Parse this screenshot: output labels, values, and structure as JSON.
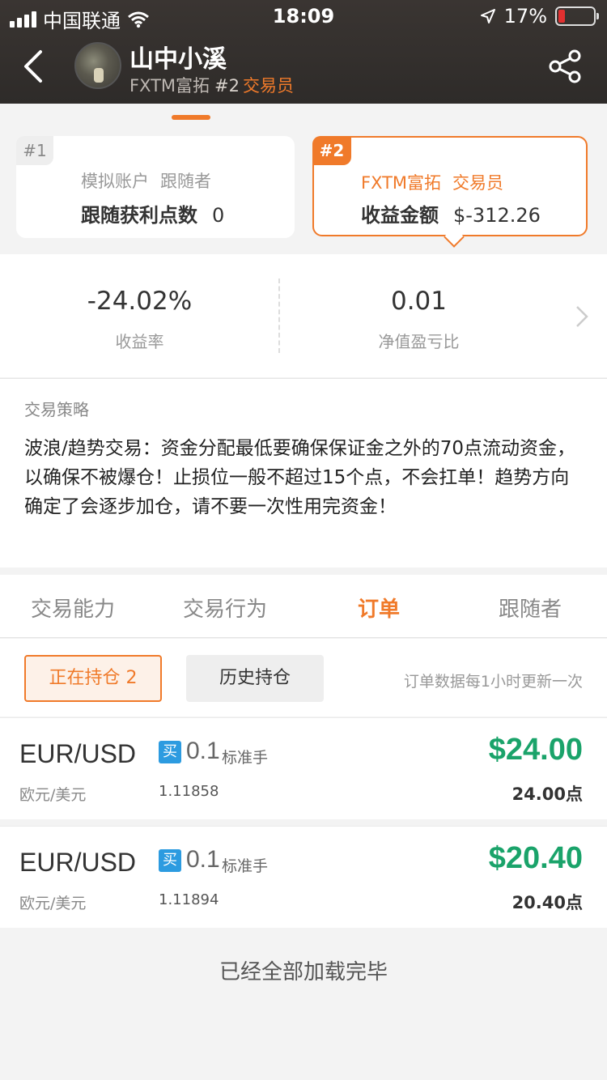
{
  "status_bar": {
    "carrier": "中国联通",
    "time": "18:09",
    "battery": "17%",
    "icons": [
      "signal-icon",
      "wifi-icon",
      "location-arrow-icon",
      "battery-icon"
    ]
  },
  "header": {
    "name": "山中小溪",
    "broker": "FXTM富拓",
    "rank": "#2",
    "role": "交易员",
    "icons": [
      "back-icon",
      "avatar",
      "share-icon"
    ]
  },
  "cards": [
    {
      "badge": "#1",
      "line1a": "模拟账户",
      "line1b": "跟随者",
      "label": "跟随获利点数",
      "value": "0"
    },
    {
      "badge": "#2",
      "line1a": "FXTM富拓",
      "line1b": "交易员",
      "label": "收益金额",
      "value": "$-312.26"
    }
  ],
  "stats": [
    {
      "value": "-24.02%",
      "label": "收益率"
    },
    {
      "value": "0.01",
      "label": "净值盈亏比"
    }
  ],
  "strategy": {
    "title": "交易策略",
    "text": "波浪/趋势交易：资金分配最低要确保保证金之外的70点流动资金，以确保不被爆仓！止损位一般不超过15个点，不会扛单！趋势方向确定了会逐步加仓，请不要一次性用完资金！"
  },
  "tabs": [
    {
      "label": "交易能力",
      "active": false
    },
    {
      "label": "交易行为",
      "active": false
    },
    {
      "label": "订单",
      "active": true
    },
    {
      "label": "跟随者",
      "active": false
    }
  ],
  "filter": {
    "open_label": "正在持仓 2",
    "history_label": "历史持仓",
    "note": "订单数据每1小时更新一次"
  },
  "orders": [
    {
      "pair": "EUR/USD",
      "side": "买",
      "lots": "0.1",
      "unit": "标准手",
      "pair_cn": "欧元/美元",
      "price": "1.11858",
      "profit": "$24.00",
      "points": "24.00点"
    },
    {
      "pair": "EUR/USD",
      "side": "买",
      "lots": "0.1",
      "unit": "标准手",
      "pair_cn": "欧元/美元",
      "price": "1.11894",
      "profit": "$20.40",
      "points": "20.40点"
    }
  ],
  "footer": {
    "message": "已经全部加载完毕"
  },
  "colors": {
    "accent": "#f07a2a",
    "profit": "#1aa36a",
    "buy": "#2c9be0",
    "header_bg": "#2e2b29"
  }
}
